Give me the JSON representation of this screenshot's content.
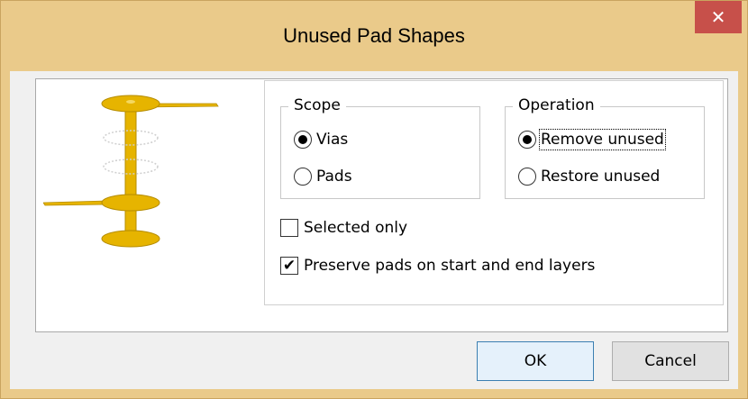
{
  "window": {
    "title": "Unused Pad Shapes",
    "close_glyph": "✕"
  },
  "scope": {
    "legend": "Scope",
    "options": [
      "Vias",
      "Pads"
    ],
    "selected": "Vias"
  },
  "operation": {
    "legend": "Operation",
    "options": [
      "Remove unused",
      "Restore unused"
    ],
    "selected": "Remove unused"
  },
  "checkboxes": {
    "selected_only": {
      "label": "Selected only",
      "checked": false
    },
    "preserve_pads": {
      "label": "Preserve pads on start and end layers",
      "checked": true,
      "glyph": "✔"
    }
  },
  "buttons": {
    "ok": "OK",
    "cancel": "Cancel"
  },
  "colors": {
    "pad_gold": "#e6b400",
    "frame": "#eaca8a",
    "close_red": "#c7504a"
  },
  "icons": {
    "illustration": "via-pad-stack-icon",
    "close": "close-icon"
  }
}
